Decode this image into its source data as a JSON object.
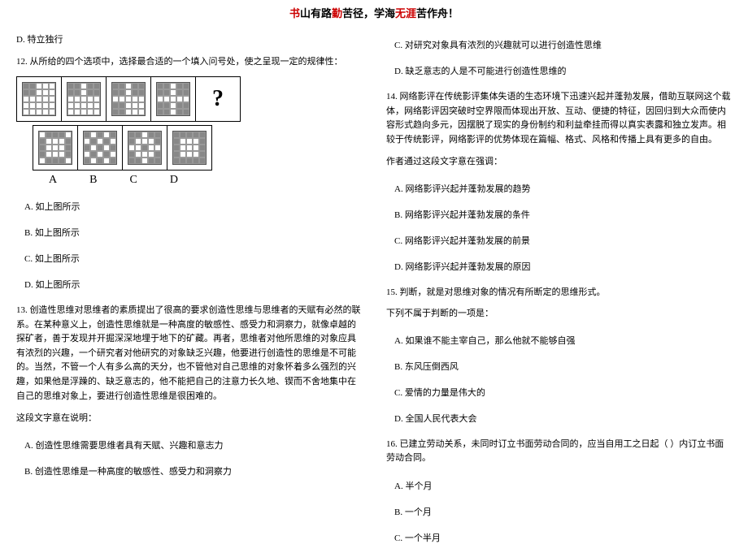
{
  "header": {
    "p1": "书",
    "p2": "山有路",
    "p3": "勤",
    "p4": "苦径，学海",
    "p5": "无涯",
    "p6": "苦作舟！"
  },
  "left": {
    "optD11": "D. 特立独行",
    "q12": "12. 从所给的四个选项中，选择最合适的一个填入问号处，使之呈现一定的规律性：",
    "labelA": "A",
    "labelB": "B",
    "labelC": "C",
    "labelD": "D",
    "optA12": "A. 如上图所示",
    "optB12": "B. 如上图所示",
    "optC12": "C. 如上图所示",
    "optD12": "D. 如上图所示",
    "q13p1": "13. 创造性思维对思维者的素质提出了很高的要求创造性思维与思维者的天赋有必然的联系。在某种意义上，创造性思维就是一种高度的敏感性、感受力和洞察力，就像卓越的探矿者，善于发现并开掘深深地埋于地下的矿藏。再者，思维者对他所思维的对象应具有浓烈的兴趣，一个研究者对他研究的对象缺乏兴趣，他要进行创造性的思维是不可能的。当然，不管一个人有多么高的天分，也不管他对自己思维的对象怀着多么强烈的兴趣，如果他是浮躁的、缺乏意志的，他不能把自己的注意力长久地、锲而不舍地集中在自己的思维对象上，要进行创造性思维是很困难的。",
    "q13p2": "这段文字意在说明：",
    "optA13": "A. 创造性思维需要思维者具有天赋、兴趣和意志力",
    "optB13": "B. 创造性思维是一种高度的敏感性、感受力和洞察力"
  },
  "right": {
    "optC13": "C. 对研究对象具有浓烈的兴趣就可以进行创造性思维",
    "optD13": "D. 缺乏意志的人是不可能进行创造性思维的",
    "q14p1": "14. 网络影评在传统影评集体失语的生态环境下迅速兴起并蓬勃发展，借助互联网这个载体，网络影评因突破时空界限而体现出开放、互动、便捷的特征，因回归到大众而使内容形式趋向多元，因摆脱了现实的身份制约和利益牵挂而得以真实表露和独立发声。相较于传统影评，网络影评的优势体现在篇幅、格式、风格和传播上具有更多的自由。",
    "q14p2": "作者通过这段文字意在强调：",
    "optA14": "A. 网络影评兴起并蓬勃发展的趋势",
    "optB14": "B. 网络影评兴起并蓬勃发展的条件",
    "optC14": "C. 网络影评兴起并蓬勃发展的前景",
    "optD14": "D. 网络影评兴起并蓬勃发展的原因",
    "q15p1": "15. 判断，就是对思维对象的情况有所断定的思维形式。",
    "q15p2": "下列不属于判断的一项是：",
    "optA15": "A. 如果谁不能主宰自己，那么他就不能够自强",
    "optB15": "B. 东风压倒西风",
    "optC15": "C. 爱情的力量是伟大的",
    "optD15": "D. 全国人民代表大会",
    "q16": "16. 已建立劳动关系，未同时订立书面劳动合同的，应当自用工之日起（        ）内订立书面劳动合同。",
    "optA16": "A. 半个月",
    "optB16": "B. 一个月",
    "optC16": "C. 一个半月"
  }
}
